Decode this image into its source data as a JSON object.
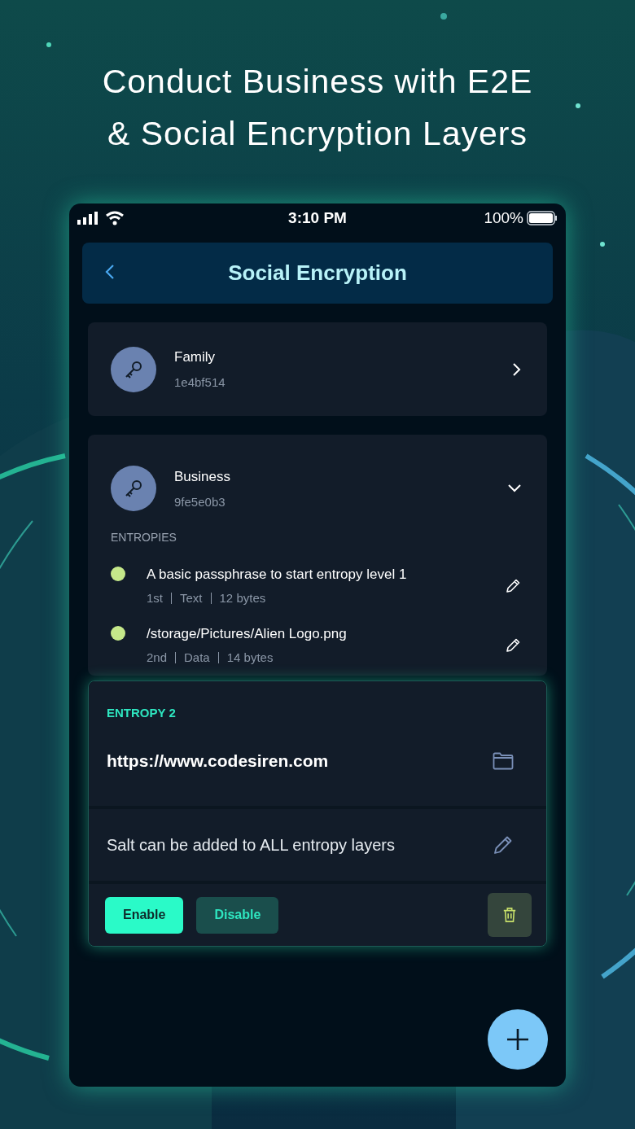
{
  "headline": [
    "Conduct Business with E2E",
    "& Social Encryption Layers"
  ],
  "status_bar": {
    "time": "3:10 PM",
    "battery": "100%"
  },
  "header": {
    "title": "Social Encryption"
  },
  "groups": [
    {
      "name": "Family",
      "code": "1e4bf514",
      "expanded": false
    },
    {
      "name": "Business",
      "code": "9fe5e0b3",
      "expanded": true,
      "section_label": "ENTROPIES",
      "entropies": [
        {
          "text": "A basic passphrase to start entropy level 1",
          "order": "1st",
          "type": "Text",
          "size": "12 bytes"
        },
        {
          "text": "/storage/Pictures/Alien Logo.png",
          "order": "2nd",
          "type": "Data",
          "size": "14 bytes"
        }
      ]
    }
  ],
  "editor": {
    "label": "ENTROPY 2",
    "value": "https://www.codesiren.com",
    "salt_placeholder": "Salt can be added to ALL entropy layers",
    "buttons": [
      {
        "label": "Enable",
        "selected": true
      },
      {
        "label": "Disable",
        "selected": false
      }
    ]
  }
}
